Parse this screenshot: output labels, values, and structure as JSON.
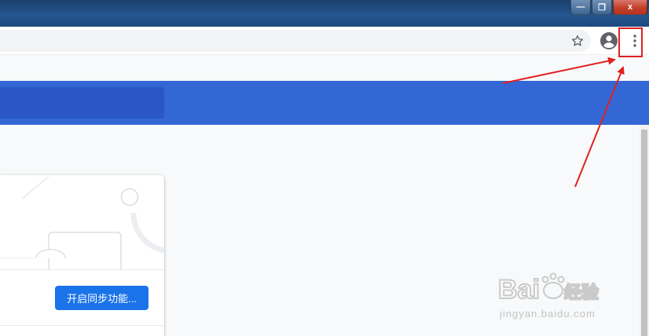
{
  "window_controls": {
    "minimize_glyph": "—",
    "maximize_glyph": "❐",
    "close_glyph": "x"
  },
  "toolbar": {
    "star_icon": "star-icon",
    "avatar_icon": "account-circle-icon",
    "menu_icon": "more-vert-icon"
  },
  "sync_card": {
    "button_label": "开启同步功能..."
  },
  "watermark": {
    "brand": "Bai du 经验",
    "url": "jingyan.baidu.com"
  },
  "colors": {
    "header_blue": "#3367d6",
    "button_blue": "#1a73e8",
    "annotation_red": "#e02020"
  }
}
